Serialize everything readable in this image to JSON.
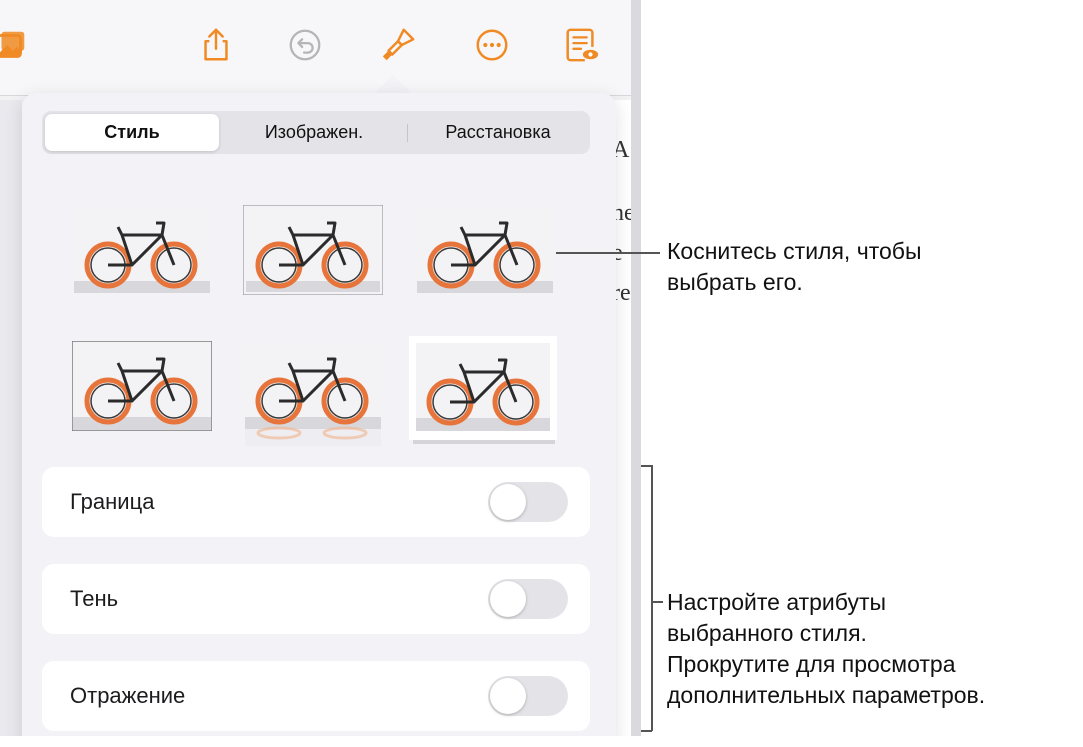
{
  "toolbar": {
    "icons": [
      "photo-icon",
      "share-icon",
      "undo-icon",
      "format-brush-icon",
      "more-icon",
      "reader-view-icon"
    ]
  },
  "popover": {
    "tabs": [
      {
        "label": "Стиль",
        "active": true
      },
      {
        "label": "Изображен.",
        "active": false
      },
      {
        "label": "Расстановка",
        "active": false
      }
    ],
    "style_presets": [
      "bicycle-style-1",
      "bicycle-style-2",
      "bicycle-style-3",
      "bicycle-style-4",
      "bicycle-style-5",
      "bicycle-style-6"
    ],
    "toggles": [
      {
        "label": "Граница",
        "on": false
      },
      {
        "label": "Тень",
        "on": false
      },
      {
        "label": "Отражение",
        "on": false
      }
    ]
  },
  "document_fragments": [
    "A",
    "ne",
    "e",
    "re"
  ],
  "callouts": {
    "styles": [
      "Коснитесь стиля, чтобы",
      "выбрать его."
    ],
    "attributes": [
      "Настройте атрибуты",
      "выбранного стиля.",
      "Прокрутите для просмотра",
      "дополнительных параметров."
    ]
  },
  "colors": {
    "accent": "#f08a24",
    "panel": "#f2f2f7",
    "toggle_off": "#e4e4e8"
  }
}
